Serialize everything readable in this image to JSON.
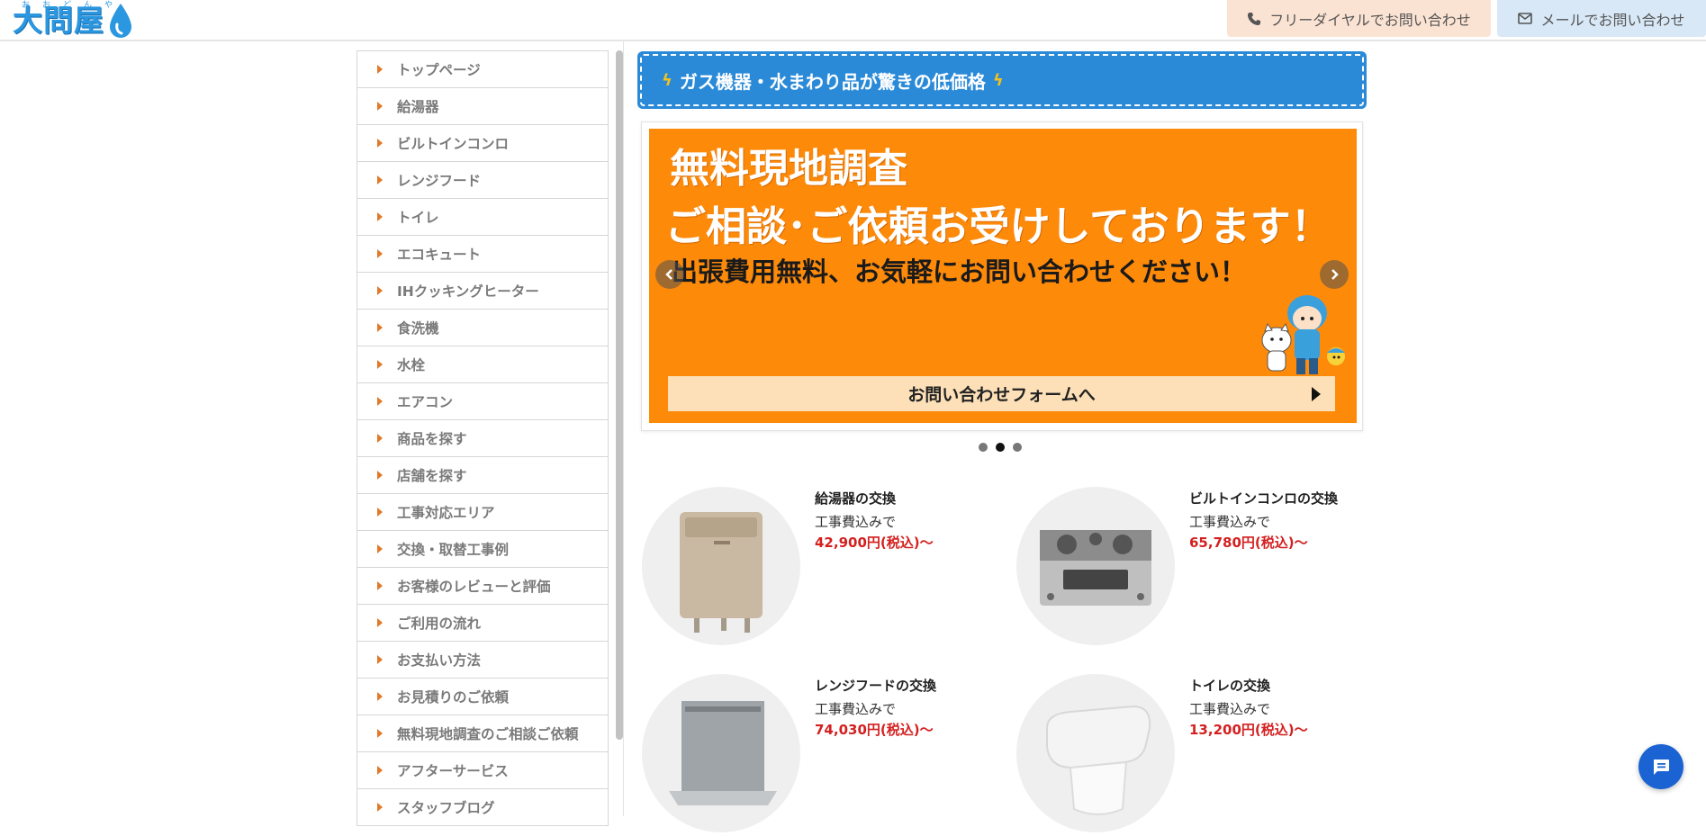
{
  "header": {
    "logo_text": "大問屋",
    "logo_ruby": "おおどんや",
    "phone_label": "フリーダイヤルでお問い合わせ",
    "mail_label": "メールでお問い合わせ"
  },
  "sidebar": {
    "items": [
      {
        "label": "トップページ"
      },
      {
        "label": "給湯器"
      },
      {
        "label": "ビルトインコンロ"
      },
      {
        "label": "レンジフード"
      },
      {
        "label": "トイレ"
      },
      {
        "label": "エコキュート"
      },
      {
        "label": "IHクッキングヒーター"
      },
      {
        "label": "食洗機"
      },
      {
        "label": "水栓"
      },
      {
        "label": "エアコン"
      },
      {
        "label": "商品を探す"
      },
      {
        "label": "店舗を探す"
      },
      {
        "label": "工事対応エリア"
      },
      {
        "label": "交換・取替工事例"
      },
      {
        "label": "お客様のレビューと評価"
      },
      {
        "label": "ご利用の流れ"
      },
      {
        "label": "お支払い方法"
      },
      {
        "label": "お見積りのご依頼"
      },
      {
        "label": "無料現地調査のご相談ご依頼"
      },
      {
        "label": "アフターサービス"
      },
      {
        "label": "スタッフブログ"
      }
    ]
  },
  "banner": {
    "text": "ガス機器・水まわり品が驚きの低価格"
  },
  "slider": {
    "title": "無料現地調査",
    "title2": "ご相談･ご依頼お受けしております！",
    "subtitle": "出張費用無料、お気軽にお問い合わせください！",
    "cta": "お問い合わせフォームへ",
    "slide_count": 3,
    "active_index": 1
  },
  "products": [
    {
      "name": "給湯器の交換",
      "sub": "工事費込みで",
      "price": "42,900円(税込)〜"
    },
    {
      "name": "ビルトインコンロの交換",
      "sub": "工事費込みで",
      "price": "65,780円(税込)〜"
    },
    {
      "name": "レンジフードの交換",
      "sub": "工事費込みで",
      "price": "74,030円(税込)〜"
    },
    {
      "name": "トイレの交換",
      "sub": "工事費込みで",
      "price": "13,200円(税込)〜"
    }
  ],
  "colors": {
    "brand_blue": "#2a8ad8",
    "slide_orange": "#fe8a0a",
    "price_red": "#d42020",
    "chat_blue": "#1b63d3"
  }
}
